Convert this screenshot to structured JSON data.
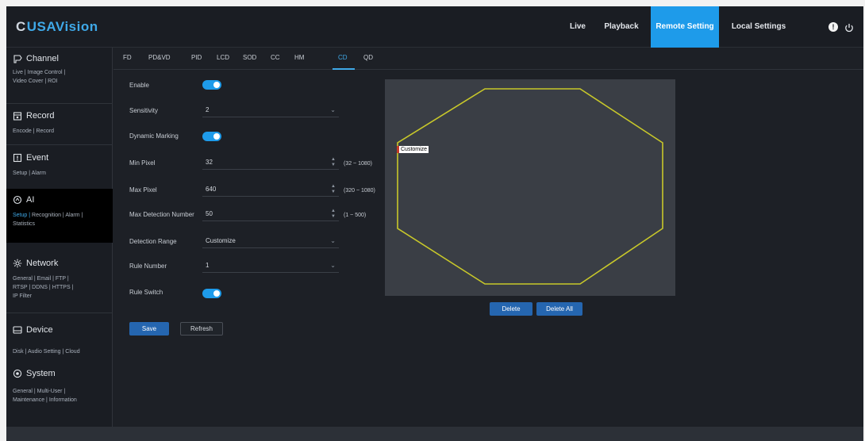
{
  "brand": {
    "logo_mark": "C",
    "logo_text": "USAVision"
  },
  "nav": {
    "live": "Live",
    "playback": "Playback",
    "remote_setting": "Remote Setting",
    "local_settings": "Local Settings",
    "active": "remote_setting"
  },
  "sidebar": {
    "channel": {
      "title": "Channel",
      "links": [
        "Live |",
        "Image Control |",
        "Video Cover |",
        "ROI"
      ]
    },
    "record": {
      "title": "Record",
      "links": [
        "Encode |",
        "Record"
      ]
    },
    "event": {
      "title": "Event",
      "links": [
        "Setup |",
        "Alarm"
      ]
    },
    "ai": {
      "title": "AI",
      "links": [
        "Setup |",
        "Recognition |",
        "Alarm |",
        "Statistics"
      ]
    },
    "network": {
      "title": "Network",
      "links": [
        "General |",
        "Email |",
        "FTP |",
        "RTSP |",
        "DDNS |",
        "HTTPS |",
        "IP Filter"
      ]
    },
    "device": {
      "title": "Device",
      "links": [
        "Disk |",
        "Audio Setting |",
        "Cloud"
      ]
    },
    "system": {
      "title": "System",
      "links": [
        "General |",
        "Multi-User |",
        "Maintenance |",
        "Information"
      ]
    }
  },
  "tabs": [
    "FD",
    "PD&VD",
    "PID",
    "LCD",
    "SOD",
    "CC",
    "HM",
    "CD",
    "QD"
  ],
  "active_tab": "CD",
  "form": {
    "enable_label": "Enable",
    "enable_on": true,
    "sensitivity_label": "Sensitivity",
    "sensitivity_value": "2",
    "dynamic_marking_label": "Dynamic Marking",
    "dynamic_marking_on": true,
    "min_pixel_label": "Min Pixel",
    "min_pixel_value": "32",
    "min_pixel_range": "(32 ~ 1080)",
    "max_pixel_label": "Max Pixel",
    "max_pixel_value": "640",
    "max_pixel_range": "(320 ~ 1080)",
    "max_detection_label": "Max Detection Number",
    "max_detection_value": "50",
    "max_detection_range": "(1 ~ 500)",
    "detection_range_label": "Detection Range",
    "detection_range_value": "Customize",
    "rule_number_label": "Rule Number",
    "rule_number_value": "1",
    "rule_switch_label": "Rule Switch",
    "rule_switch_on": true
  },
  "buttons": {
    "save": "Save",
    "refresh": "Refresh",
    "delete": "Delete",
    "delete_all": "Delete All"
  },
  "preview": {
    "region_label": "Customize",
    "region_color": "#c8c82a"
  },
  "colors": {
    "accent": "#1e9bea",
    "primary_button": "#2566b0"
  }
}
